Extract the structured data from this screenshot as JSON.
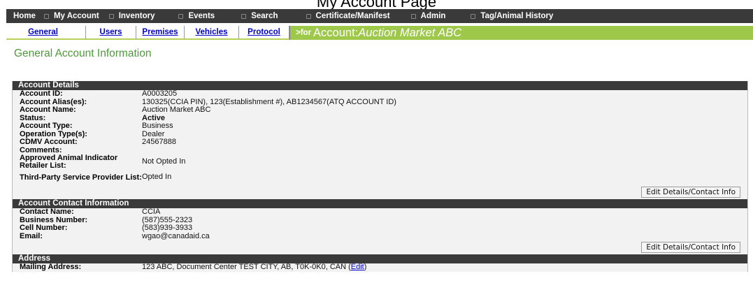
{
  "page_title": "My Account Page",
  "nav": {
    "home": "Home",
    "my_account": "My Account",
    "inventory": "Inventory",
    "events": "Events",
    "search": "Search",
    "certificate": "Certificate/Manifest",
    "admin": "Admin",
    "tag_history": "Tag/Animal History"
  },
  "tabs": {
    "general": "General",
    "users": "Users",
    "premises": "Premises",
    "vehicles": "Vehicles",
    "protocol": "Protocol"
  },
  "account_bar": {
    "prefix": ">for",
    "label": "Account:",
    "name": "Auction Market ABC"
  },
  "section_title": "General Account Information",
  "details": {
    "header": "Account Details",
    "rows": [
      {
        "label": "Account ID:",
        "value": "A0003205"
      },
      {
        "label": "Account Alias(es):",
        "value": "130325(CCIA PIN), 123(Establishment #), AB1234567(ATQ ACCOUNT ID)"
      },
      {
        "label": "Account Name:",
        "value": "Auction Market ABC"
      },
      {
        "label": "Status:",
        "value": "Active"
      },
      {
        "label": "Account Type:",
        "value": "Business"
      },
      {
        "label": "Operation Type(s):",
        "value": "Dealer"
      },
      {
        "label": "CDMV Account:",
        "value": "24567888"
      },
      {
        "label": "Comments:",
        "value": ""
      },
      {
        "label": "Approved Animal Indicator Retailer List:",
        "value": "Not Opted In"
      },
      {
        "label": "Third-Party Service Provider List:",
        "value": "Opted In"
      }
    ],
    "button": "Edit Details/Contact Info"
  },
  "contact": {
    "header": "Account Contact Information",
    "rows": [
      {
        "label": "Contact Name:",
        "value": "CCIA"
      },
      {
        "label": "Business Number:",
        "value": "(587)555-2323"
      },
      {
        "label": "Cell Number:",
        "value": "(583)939-3933"
      },
      {
        "label": "Email:",
        "value": "wgao@canadaid.ca"
      }
    ],
    "button": "Edit Details/Contact Info"
  },
  "address": {
    "header": "Address",
    "label": "Mailing Address:",
    "value": "123 ABC, Document Center TEST CITY, AB, T0K-0K0, CAN",
    "edit_link": "Edit"
  }
}
